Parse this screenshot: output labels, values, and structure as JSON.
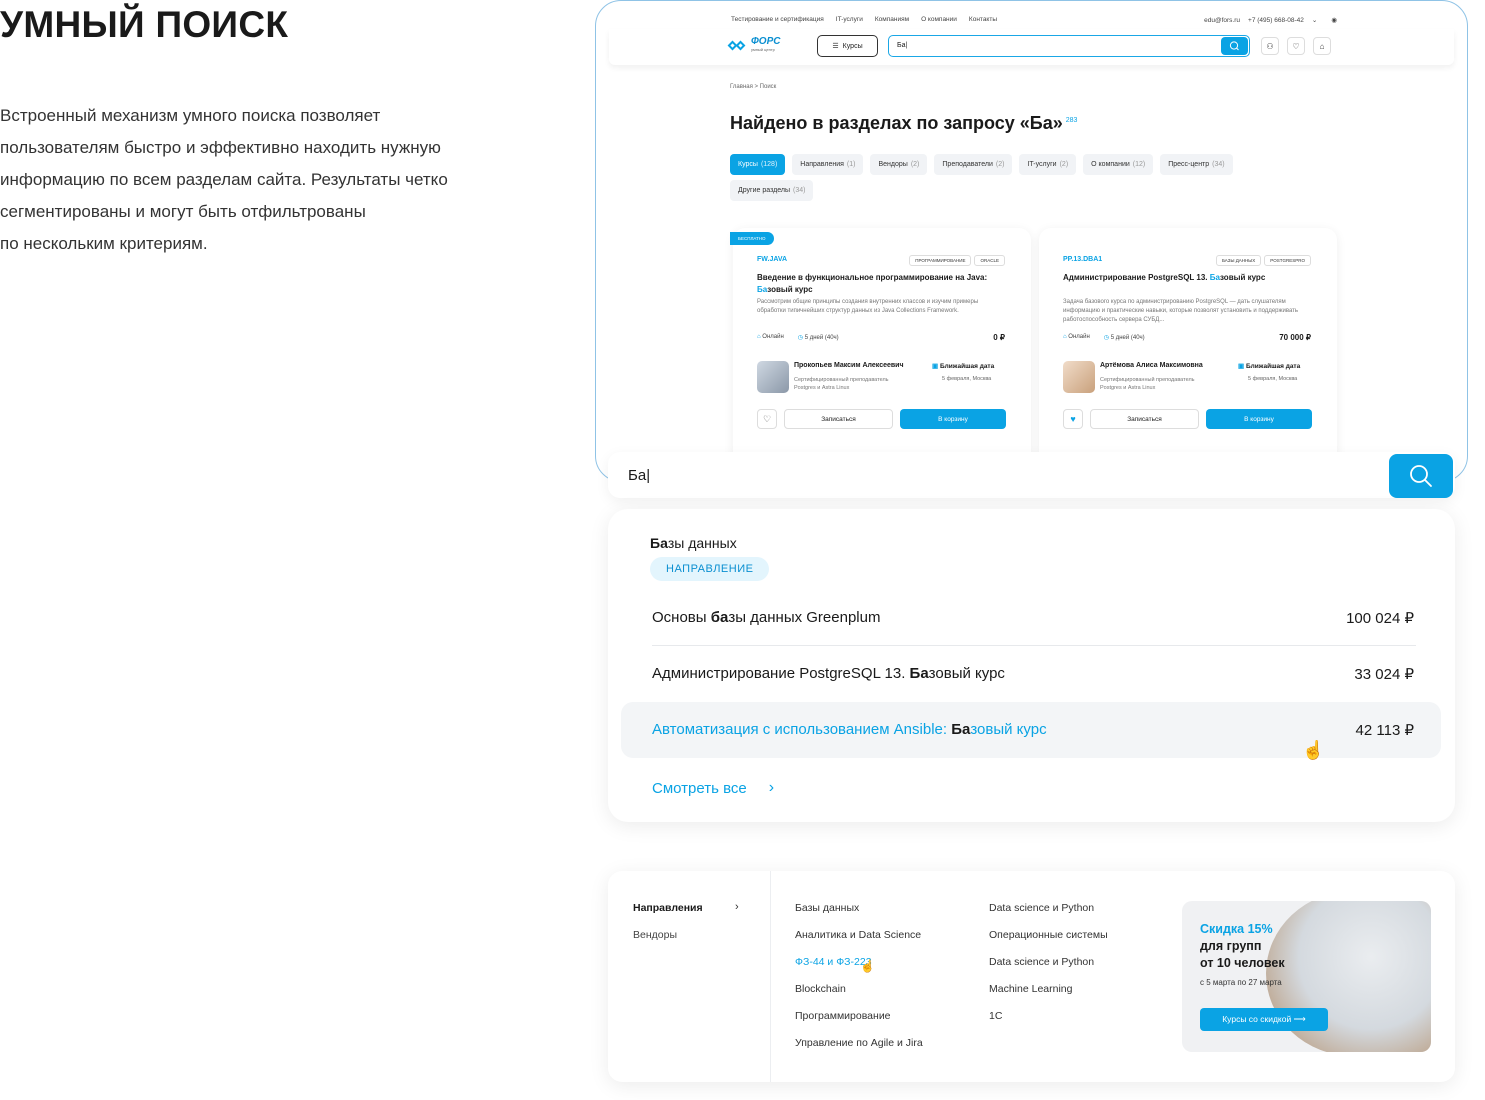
{
  "hero": {
    "title": "УМНЫЙ ПОИСК",
    "description_lines": [
      "Встроенный механизм умного поиска позволяет",
      "пользователям быстро и эффективно находить нужную",
      "информацию по всем разделам сайта. Результаты четко",
      "сегментированы и могут быть отфильтрованы",
      "по нескольким критериям."
    ]
  },
  "mock": {
    "top_links": [
      "Тестирование и сертификация",
      "IT-услуги",
      "Компаниям",
      "О компании",
      "Контакты"
    ],
    "email": "edu@fors.ru",
    "phone": "+7 (495) 668-08-42",
    "logo_name": "ФОРС",
    "logo_tagline": "умный центр",
    "courses_btn": "Курсы",
    "search_value": "Ба",
    "breadcrumbs": "Главная  >  Поиск",
    "results_title": "Найдено в разделах по запросу «Ба»",
    "results_count": "283",
    "tabs": [
      {
        "label": "Курсы",
        "count": "(128)"
      },
      {
        "label": "Направления",
        "count": "(1)"
      },
      {
        "label": "Вендоры",
        "count": "(2)"
      },
      {
        "label": "Преподаватели",
        "count": "(2)"
      },
      {
        "label": "IT-услуги",
        "count": "(2)"
      },
      {
        "label": "О компании",
        "count": "(12)"
      },
      {
        "label": "Пресс-центр",
        "count": "(34)"
      },
      {
        "label": "Другие разделы",
        "count": "(34)"
      }
    ],
    "cards": [
      {
        "badge": "БЕСПЛАТНО",
        "code": "FW.JAVA",
        "tags": [
          "ПРОГРАММИРОВАНИЕ",
          "ORACLE"
        ],
        "title_before": "Введение в функциональное программирование на Java: ",
        "title_hl": "Ба",
        "title_after": "зовый курс",
        "desc": "Рассмотрим общие принципы создания внутренних классов и изучим примеры обработки типичнейших структур данных из Java Collections Framework.",
        "format": "Онлайн",
        "duration": "5 дней (40ч)",
        "price": "0 ₽",
        "teacher": "Прокопьев Максим Алексеевич",
        "role": "Сертифицированный преподаватель Postgres и Astra Linux",
        "date_label": "Ближайшая дата",
        "date_value": "5 февраля, Москва",
        "enroll": "Записаться",
        "cart": "В корзину"
      },
      {
        "badge": "",
        "code": "PP.13.DBA1",
        "tags": [
          "БАЗЫ ДАННЫХ",
          "POSTGRESPRO"
        ],
        "title_before": "Администрирование PostgreSQL 13. ",
        "title_hl": "Ба",
        "title_after": "зовый курс",
        "desc": "Задача базового курса по администрированию PostgreSQL — дать слушателям информацию и практические навыки, которые позволят установить и поддерживать работоспособность сервера СУБД...",
        "format": "Онлайн",
        "duration": "5 дней (40ч)",
        "price": "70 000 ₽",
        "teacher": "Артёмова Алиса Максимовна",
        "role": "Сертифицированный преподаватель Postgres и Astra Linux",
        "date_label": "Ближайшая дата",
        "date_value": "5 февраля, Москва",
        "enroll": "Записаться",
        "cart": "В корзину"
      }
    ]
  },
  "search": {
    "value": "Ба",
    "direction_hl": "Ба",
    "direction_rest": "зы данных",
    "direction_badge": "НАПРАВЛЕНИЕ",
    "suggestions": [
      {
        "before": "Основы ",
        "hl": "ба",
        "after": "зы данных Greenplum",
        "price": "100 024 ₽"
      },
      {
        "before": "Администрирование PostgreSQL 13. ",
        "hl": "Ба",
        "after": "зовый курс",
        "price": "33 024 ₽"
      },
      {
        "before": "Автоматизация с использованием Ansible: ",
        "hl": "Ба",
        "after": "зовый курс",
        "price": "42 113 ₽"
      }
    ],
    "see_all": "Смотреть все"
  },
  "mega": {
    "categories": [
      "Направления",
      "Вендоры"
    ],
    "col1": [
      "Базы данных",
      "Аналитика и Data Science",
      "ФЗ-44 и ФЗ-223",
      "Blockchain",
      "Программирование",
      "Управление по Agile и Jira"
    ],
    "col2": [
      "Data science и Python",
      "Операционные системы",
      "Data science и Python",
      "Machine Learning",
      "1С"
    ],
    "promo": {
      "hl": "Скидка 15%",
      "line2": "для групп",
      "line3": "от 10 человек",
      "date": "с 5 марта по 27 марта",
      "button": "Курсы со скидкой ⟶"
    }
  },
  "colors": {
    "accent": "#0aa3e4",
    "text": "#1a1a1a",
    "hover_bg": "#f3f5f7"
  }
}
